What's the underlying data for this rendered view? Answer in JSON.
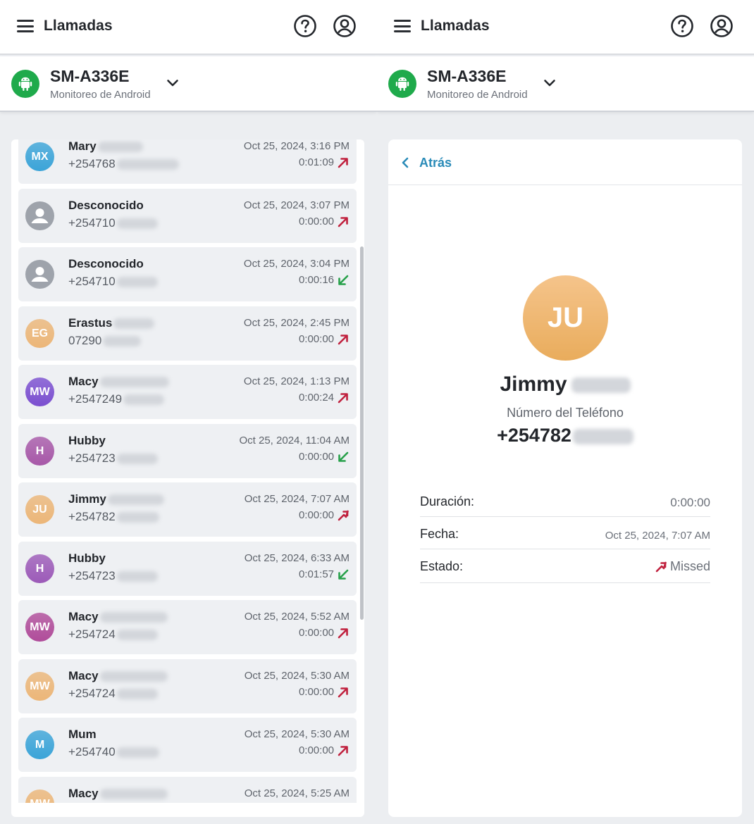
{
  "app": {
    "title": "Llamadas",
    "device_name": "SM-A336E",
    "device_subtitle": "Monitoreo de Android"
  },
  "calls": [
    {
      "name": "Mary",
      "number": "+254768",
      "initials": "MX",
      "avatar_color": "#3ba4d8",
      "date": "Oct 25, 2024, 3:16 PM",
      "duration": "0:01:09",
      "direction": "outgoing"
    },
    {
      "name": "Desconocido",
      "number": "+254710",
      "initials": "",
      "avatar_color": "#9ea3ab",
      "date": "Oct 25, 2024, 3:07 PM",
      "duration": "0:00:00",
      "direction": "outgoing"
    },
    {
      "name": "Desconocido",
      "number": "+254710",
      "initials": "",
      "avatar_color": "#9ea3ab",
      "date": "Oct 25, 2024, 3:04 PM",
      "duration": "0:00:16",
      "direction": "incoming"
    },
    {
      "name": "Erastus",
      "number": "07290",
      "initials": "EG",
      "avatar_color": "#ecb678",
      "date": "Oct 25, 2024, 2:45 PM",
      "duration": "0:00:00",
      "direction": "outgoing"
    },
    {
      "name": "Macy",
      "number": "+2547249",
      "initials": "MW",
      "avatar_color": "#7b4fd0",
      "date": "Oct 25, 2024, 1:13 PM",
      "duration": "0:00:24",
      "direction": "outgoing"
    },
    {
      "name": "Hubby",
      "number": "+254723",
      "initials": "H",
      "avatar_color": "#a758a8",
      "date": "Oct 25, 2024, 11:04 AM",
      "duration": "0:00:00",
      "direction": "incoming"
    },
    {
      "name": "Jimmy",
      "number": "+254782",
      "initials": "JU",
      "avatar_color": "#ecb678",
      "date": "Oct 25, 2024, 7:07 AM",
      "duration": "0:00:00",
      "direction": "missed"
    },
    {
      "name": "Hubby",
      "number": "+254723",
      "initials": "H",
      "avatar_color": "#9c5ab8",
      "date": "Oct 25, 2024, 6:33 AM",
      "duration": "0:01:57",
      "direction": "incoming"
    },
    {
      "name": "Macy",
      "number": "+254724",
      "initials": "MW",
      "avatar_color": "#b04c9a",
      "date": "Oct 25, 2024, 5:52 AM",
      "duration": "0:00:00",
      "direction": "outgoing"
    },
    {
      "name": "Macy",
      "number": "+254724",
      "initials": "MW",
      "avatar_color": "#ecb678",
      "date": "Oct 25, 2024, 5:30 AM",
      "duration": "0:00:00",
      "direction": "outgoing"
    },
    {
      "name": "Mum",
      "number": "+254740",
      "initials": "M",
      "avatar_color": "#3ba4d8",
      "date": "Oct 25, 2024, 5:30 AM",
      "duration": "0:00:00",
      "direction": "outgoing"
    },
    {
      "name": "Macy",
      "number": "",
      "initials": "MW",
      "avatar_color": "#ecb678",
      "date": "Oct 25, 2024, 5:25 AM",
      "duration": "",
      "direction": "none"
    }
  ],
  "detail": {
    "back_label": "Atrás",
    "initials": "JU",
    "name": "Jimmy",
    "phone_label": "Número del Teléfono",
    "phone_value": "+254782",
    "duration_label": "Duración:",
    "duration_value": "0:00:00",
    "date_label": "Fecha:",
    "date_value": "Oct 25, 2024, 7:07 AM",
    "status_label": "Estado:",
    "status_value": "Missed"
  },
  "colors": {
    "android_green": "#1faa4b",
    "link_blue": "#2a8bb8",
    "outgoing_red": "#c0213e",
    "incoming_green": "#27a04a"
  }
}
